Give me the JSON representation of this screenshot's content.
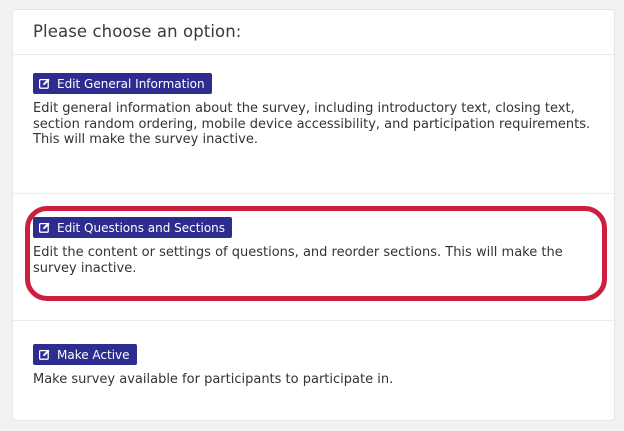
{
  "header": {
    "title": "Please choose an option:"
  },
  "options": [
    {
      "button_label": "Edit General Information",
      "icon": "edit-icon",
      "description": "Edit general information about the survey, including introductory text, closing text, section random ordering, mobile device accessibility, and participation requirements. This will make the survey inactive."
    },
    {
      "button_label": "Edit Questions and Sections",
      "icon": "edit-icon",
      "description": "Edit the content or settings of questions, and reorder sections. This will make the survey inactive."
    },
    {
      "button_label": "Make Active",
      "icon": "edit-icon",
      "description": "Make survey available for participants to participate in."
    }
  ],
  "colors": {
    "button_bg": "#2c2d8f",
    "highlight": "#cc1f3e"
  }
}
